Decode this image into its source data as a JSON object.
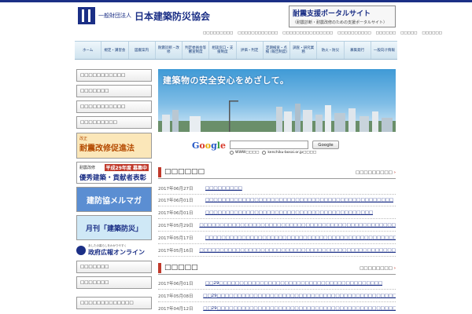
{
  "header": {
    "org_small": "一般財団法人",
    "org_name": "日本建築防災協会",
    "portal_title": "耐震支援ポータルサイト",
    "portal_sub": "（耐震診断・耐震改修のための支援ポータルサイト）"
  },
  "sublinks": [
    "□□□□□□□□□",
    "□□□□□□□□□□□□",
    "□□□□□□□□□□□□□□□",
    "□□□□□□□□□□",
    "□□□□□□",
    "□□□□□",
    "□□□□□□"
  ],
  "nav": [
    "ホーム",
    "規定・講習会",
    "図書案内",
    "耐震診断・改修",
    "判定委員会等 審査制度",
    "相談窓口・支援制度",
    "評価・判定",
    "定期検査・点検 (報告制度)",
    "調査・研究業務",
    "防火・防災",
    "募集発行",
    "一般向け情報"
  ],
  "sidebar": {
    "links_top": [
      "□□□□□□□□□□□",
      "□□□□□□□",
      "□□□□□□□□□□□",
      "□□□□□□□□□"
    ],
    "banner_taishin_small": "改正",
    "banner_taishin_main": "耐震改修促進法",
    "banner_award_small": "耐震改修",
    "banner_award_highlight": "平成29年度 募集中",
    "banner_award_main": "優秀建築・貢献者表彰",
    "banner_mailmag": "建防協メルマガ",
    "banner_monthly": "月刊「建築防災」",
    "gov_small": "あしたの暮らしをわかりやすく",
    "gov_title": "政府広報オンライン",
    "links_bottom": [
      "□□□□□□□",
      "□□□□□□□",
      "□□□□□□□□□□□□□"
    ]
  },
  "hero": {
    "slogan": "建築物の安全安心をめざして。"
  },
  "search": {
    "google_parts": [
      "G",
      "o",
      "o",
      "g",
      "l",
      "e"
    ],
    "button": "Google",
    "radio_www": "WWW□□□□",
    "radio_site": "kenchiku-bosai.or.jp□□□□"
  },
  "news": {
    "title": "□□□□□□",
    "more": "□□□□□□□□□",
    "items": [
      {
        "date": "2017年06月27日",
        "text": "□□□□□□□□□"
      },
      {
        "date": "2017年06月01日",
        "text": "□□□□□□□□□□□□□□□□□□□□□□□□□□□□□□□□□□□□□□□□□□□□□□"
      },
      {
        "date": "2017年06月01日",
        "text": "□□□□□□□□□□□□□□□□□□□□□□□□□□□□□□□□□□□□□□□□□"
      },
      {
        "date": "2017年05月29日",
        "text": "□□□□□□□□□□□□□□□□□□□□□□□□□□□□□□□□□□□□□□□□□□□□□□□□□□□□□□□"
      },
      {
        "date": "2017年05月17日",
        "text": "□□□□□□□□□□□□□□□□□□□□□□□□□□□□□□□□□□□□□□□□□□□□□□□"
      },
      {
        "date": "2017年05月16日",
        "text": "□□□□□□□□□□□□□□□□□□□□□□□□□□□□□□□□□□□□□□□□□□□□□□□□□□□□□□□"
      }
    ]
  },
  "section2": {
    "title": "□□□□□",
    "more": "□□□□□□□□",
    "items": [
      {
        "date": "2017年06月01日",
        "text": "□□29□□□□□□□□□□□□□□□□□□□□□□□□□□□□□□□□□□□□□□□□"
      },
      {
        "date": "2017年05月08日",
        "text": "□□29□□□□□□□□□□□□□□□□□□□□□□□□□□□□□□□□□□□□□□□□□□□□□□"
      },
      {
        "date": "2017年04月12日",
        "text": "□□29□□□□□□□□□□□□□□□□□□□□□□□□□□□□□□□□□□□□□□□□□□□□□□"
      }
    ]
  },
  "colors": {
    "brand": "#1b2f86",
    "accent": "#c0392b",
    "nav_bg": "#cfe3ef"
  }
}
